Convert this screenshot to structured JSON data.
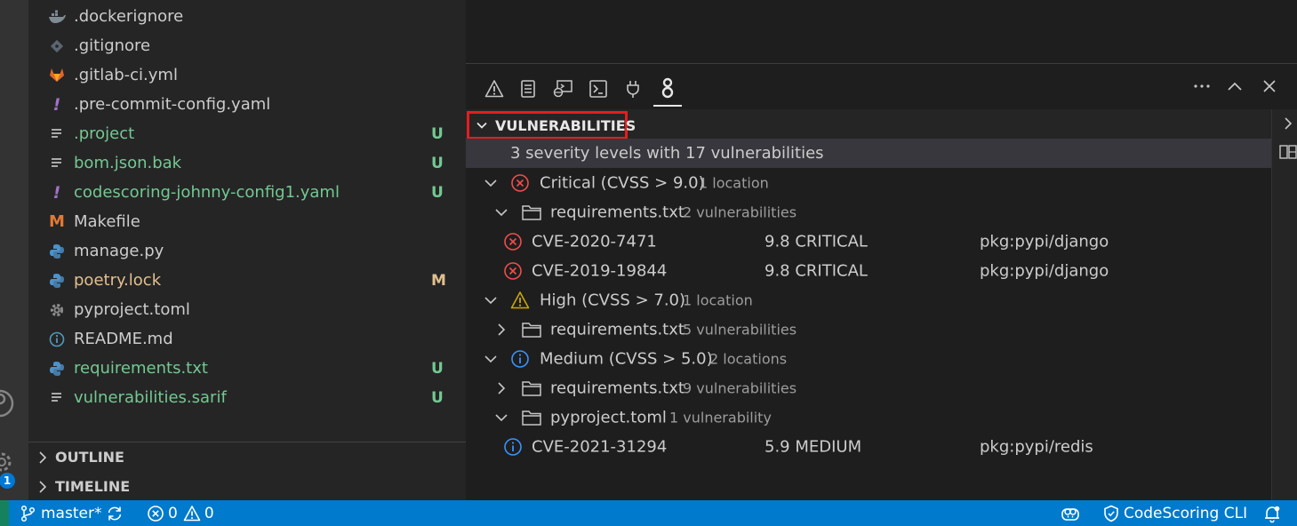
{
  "explorer": {
    "files": [
      {
        "name": ".dockerignore",
        "icon": "docker-icon",
        "color": "default",
        "status": ""
      },
      {
        "name": ".gitignore",
        "icon": "git-icon",
        "color": "default",
        "status": ""
      },
      {
        "name": ".gitlab-ci.yml",
        "icon": "gitlab-icon",
        "color": "default",
        "status": ""
      },
      {
        "name": ".pre-commit-config.yaml",
        "icon": "yaml-icon",
        "color": "default",
        "status": ""
      },
      {
        "name": ".project",
        "icon": "text-file-icon",
        "color": "added",
        "status": "U"
      },
      {
        "name": "bom.json.bak",
        "icon": "text-file-icon",
        "color": "added",
        "status": "U"
      },
      {
        "name": "codescoring-johnny-config1.yaml",
        "icon": "yaml-icon",
        "color": "added",
        "status": "U"
      },
      {
        "name": "Makefile",
        "icon": "makefile-icon",
        "color": "default",
        "status": ""
      },
      {
        "name": "manage.py",
        "icon": "python-icon",
        "color": "default",
        "status": ""
      },
      {
        "name": "poetry.lock",
        "icon": "python-icon",
        "color": "modified",
        "status": "M"
      },
      {
        "name": "pyproject.toml",
        "icon": "gear-icon",
        "color": "default",
        "status": ""
      },
      {
        "name": "README.md",
        "icon": "info-icon",
        "color": "default",
        "status": ""
      },
      {
        "name": "requirements.txt",
        "icon": "python-icon",
        "color": "added",
        "status": "U"
      },
      {
        "name": "vulnerabilities.sarif",
        "icon": "text-file-icon",
        "color": "added",
        "status": "U"
      }
    ],
    "sections": [
      {
        "label": "OUTLINE"
      },
      {
        "label": "TIMELINE"
      }
    ]
  },
  "activity": {
    "badge": "1"
  },
  "panel": {
    "tabs": [
      "problems-icon",
      "output-icon",
      "debug-console-icon",
      "terminal-icon",
      "ports-icon",
      "codescoring-icon"
    ],
    "actions": [
      "more-icon",
      "maximize-icon",
      "close-icon"
    ],
    "view_title": "VULNERABILITIES",
    "summary": "3 severity levels with 17 vulnerabilities",
    "tree": {
      "critical": {
        "label": "Critical (CVSS > 9.0)",
        "desc": "1 location"
      },
      "critical_file": {
        "label": "requirements.txt",
        "desc": "2 vulnerabilities"
      },
      "cve1": {
        "id": "CVE-2020-7471",
        "score": "9.8 CRITICAL",
        "pkg": "pkg:pypi/django"
      },
      "cve2": {
        "id": "CVE-2019-19844",
        "score": "9.8 CRITICAL",
        "pkg": "pkg:pypi/django"
      },
      "high": {
        "label": "High (CVSS > 7.0)",
        "desc": "1 location"
      },
      "high_file": {
        "label": "requirements.txt",
        "desc": "5 vulnerabilities"
      },
      "medium": {
        "label": "Medium (CVSS > 5.0)",
        "desc": "2 locations"
      },
      "medium_file1": {
        "label": "requirements.txt",
        "desc": "9 vulnerabilities"
      },
      "medium_file2": {
        "label": "pyproject.toml",
        "desc": "1 vulnerability"
      },
      "cve3": {
        "id": "CVE-2021-31294",
        "score": "5.9 MEDIUM",
        "pkg": "pkg:pypi/redis"
      }
    }
  },
  "statusbar": {
    "branch": "master*",
    "errors": "0",
    "warnings": "0",
    "codescoring": "CodeScoring CLI"
  },
  "colors": {
    "critical": "#f14c4c",
    "high": "#cca700",
    "medium": "#3794ff",
    "statusbar": "#007acc",
    "added": "#73c991",
    "modified": "#e2c08d"
  }
}
